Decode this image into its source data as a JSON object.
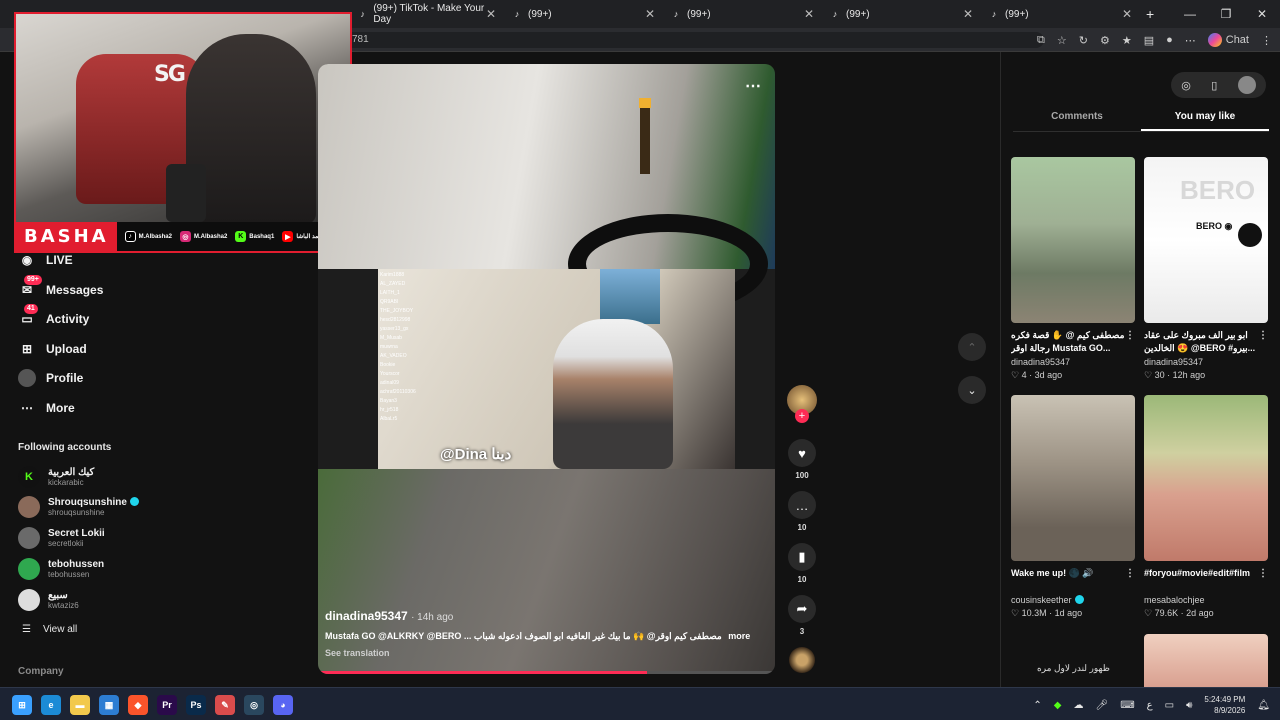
{
  "browser": {
    "tabs": [
      {
        "title": "(99+) TikTok - Make Your Day"
      },
      {
        "title": "(99+)"
      },
      {
        "title": "(99+)"
      },
      {
        "title": "(99+)"
      },
      {
        "title": "(99+)"
      }
    ],
    "url_fragment": "781",
    "chat_label": "Chat",
    "window_controls": {
      "minimize": "—",
      "restore": "❐",
      "close": "✕"
    }
  },
  "streamer_overlay": {
    "name": "BASHA",
    "logo_text": "SG",
    "socials": [
      {
        "icon": "tiktok-icon",
        "handle": "M.Albasha2",
        "color": "#000000"
      },
      {
        "icon": "instagram-icon",
        "handle": "M.Albasha2",
        "color": "#d62976"
      },
      {
        "icon": "kick-icon",
        "handle": "Bashaq1",
        "color": "#53fc18"
      },
      {
        "icon": "youtube-icon",
        "handle": "محمد الباشا",
        "color": "#ff0000"
      }
    ]
  },
  "sidebar": {
    "nav": [
      {
        "label": "LIVE",
        "icon": "live-icon",
        "badge": ""
      },
      {
        "label": "Messages",
        "icon": "messages-icon",
        "badge": "99+"
      },
      {
        "label": "Activity",
        "icon": "activity-icon",
        "badge": "41"
      },
      {
        "label": "Upload",
        "icon": "upload-icon",
        "badge": ""
      },
      {
        "label": "Profile",
        "icon": "profile-icon",
        "badge": ""
      },
      {
        "label": "More",
        "icon": "more-icon",
        "badge": ""
      }
    ],
    "following_title": "Following accounts",
    "following": [
      {
        "name": "كيك العربية",
        "handle": "kickarabic",
        "verified": false,
        "color": "#53fc18"
      },
      {
        "name": "Shrouqsunshine",
        "handle": "shrouqsunshine",
        "verified": true,
        "color": "#8a6a5a"
      },
      {
        "name": "Secret Lokii",
        "handle": "secretlokii",
        "verified": false,
        "color": "#6a6a6a"
      },
      {
        "name": "tebohussen",
        "handle": "tebohussen",
        "verified": false,
        "color": "#2fa84f"
      },
      {
        "name": "سبيع",
        "handle": "kwtaziz6",
        "verified": false,
        "color": "#dddddd"
      }
    ],
    "view_all": "View all",
    "company": "Company"
  },
  "video": {
    "author": "dinadina95347",
    "time": "· 14h ago",
    "caption": "Mustafa GO @ALKRKY @BERO ... مصطفى كيم اوقر@ 🙌 ما بيك غير العافيه ابو الصوف ادعوله شباب",
    "more_label": "more",
    "see_translation": "See translation",
    "overlay_tag": "@Dina دينا",
    "progress": 0.72,
    "chat_lines": [
      "Karim1888",
      "AL_ZAYED",
      "LAITH_1",
      "QR9ABI",
      "THE_JOYBOY",
      "hesd2812998",
      "yasser13_gx",
      "M_Musab",
      "muwrna",
      "AK_VADEO",
      "Bookie",
      "Yourscor",
      "adinal09",
      "achraf20110306",
      "Bayan3",
      "hr_jr518",
      "AlbaLr5"
    ]
  },
  "actions": [
    {
      "name": "like",
      "icon": "heart-icon",
      "glyph": "♥",
      "count": "100"
    },
    {
      "name": "comment",
      "icon": "comment-icon",
      "glyph": "…",
      "count": "10"
    },
    {
      "name": "save",
      "icon": "bookmark-icon",
      "glyph": "▮",
      "count": "10"
    },
    {
      "name": "share",
      "icon": "share-icon",
      "glyph": "➦",
      "count": "3"
    }
  ],
  "right_panel": {
    "tabs": [
      "Comments",
      "You may like"
    ],
    "active_tab": 1,
    "cards": [
      {
        "title": "مصطفى كيم @ ✋ قصة فكره رجالة اوقر Mustafa GO...",
        "author": "dinadina95347",
        "verified": false,
        "likes": "4",
        "age": "3d ago",
        "thumb_bg": "linear-gradient(180deg,#a9c7a0 0%,#9fb094 40%,#6d7a64 70%,#8c8474 100%)"
      },
      {
        "title": "ابو بير الف مبروك على عقاد الخالدين 😍 @BERO #بيرو...",
        "author": "dinadina95347",
        "verified": false,
        "likes": "30",
        "age": "12h ago",
        "thumb_bg": "linear-gradient(180deg,#f4f4f4 0%,#ffffff 50%,#eaeaea 100%)",
        "overlay_text": "BERO",
        "overlay_sub": "BERO ◉"
      },
      {
        "title": "Wake me up! 🌑 🔊",
        "author": "cousinskeether",
        "verified": true,
        "likes": "10.3M",
        "age": "1d ago",
        "thumb_bg": "linear-gradient(180deg,#c9c2b4 0%,#9e9486 40%,#6b6258 80%)"
      },
      {
        "title": "#foryou#movie#edit#film",
        "author": "mesabalochjee",
        "verified": false,
        "likes": "79.6K",
        "age": "2d ago",
        "thumb_bg": "linear-gradient(180deg,#9bb878 0%,#cfd0a0 35%,#d9a08e 60%,#c07a6a 100%)"
      }
    ],
    "footer_text": "ظهور لندر لاول مره"
  },
  "taskbar": {
    "apps": [
      {
        "icon": "windows-start-icon",
        "glyph": "⊞",
        "color": "#3aa0ff"
      },
      {
        "icon": "edge-icon",
        "glyph": "e",
        "color": "#1c8bd6"
      },
      {
        "icon": "file-explorer-icon",
        "glyph": "▬",
        "color": "#f2c94c"
      },
      {
        "icon": "store-icon",
        "glyph": "▦",
        "color": "#2d7dd2"
      },
      {
        "icon": "brave-icon",
        "glyph": "◆",
        "color": "#fb542b"
      },
      {
        "icon": "premiere-icon",
        "glyph": "Pr",
        "color": "#2a0a4a"
      },
      {
        "icon": "photoshop-icon",
        "glyph": "Ps",
        "color": "#0a2a4a"
      },
      {
        "icon": "paint-icon",
        "glyph": "✎",
        "color": "#d94c4c"
      },
      {
        "icon": "steam-icon",
        "glyph": "◎",
        "color": "#2a475e"
      },
      {
        "icon": "discord-icon",
        "glyph": "◕",
        "color": "#5865f2"
      }
    ],
    "tray_lang": "ع",
    "time": "5:24:49 PM",
    "date": "8/9/2026"
  }
}
